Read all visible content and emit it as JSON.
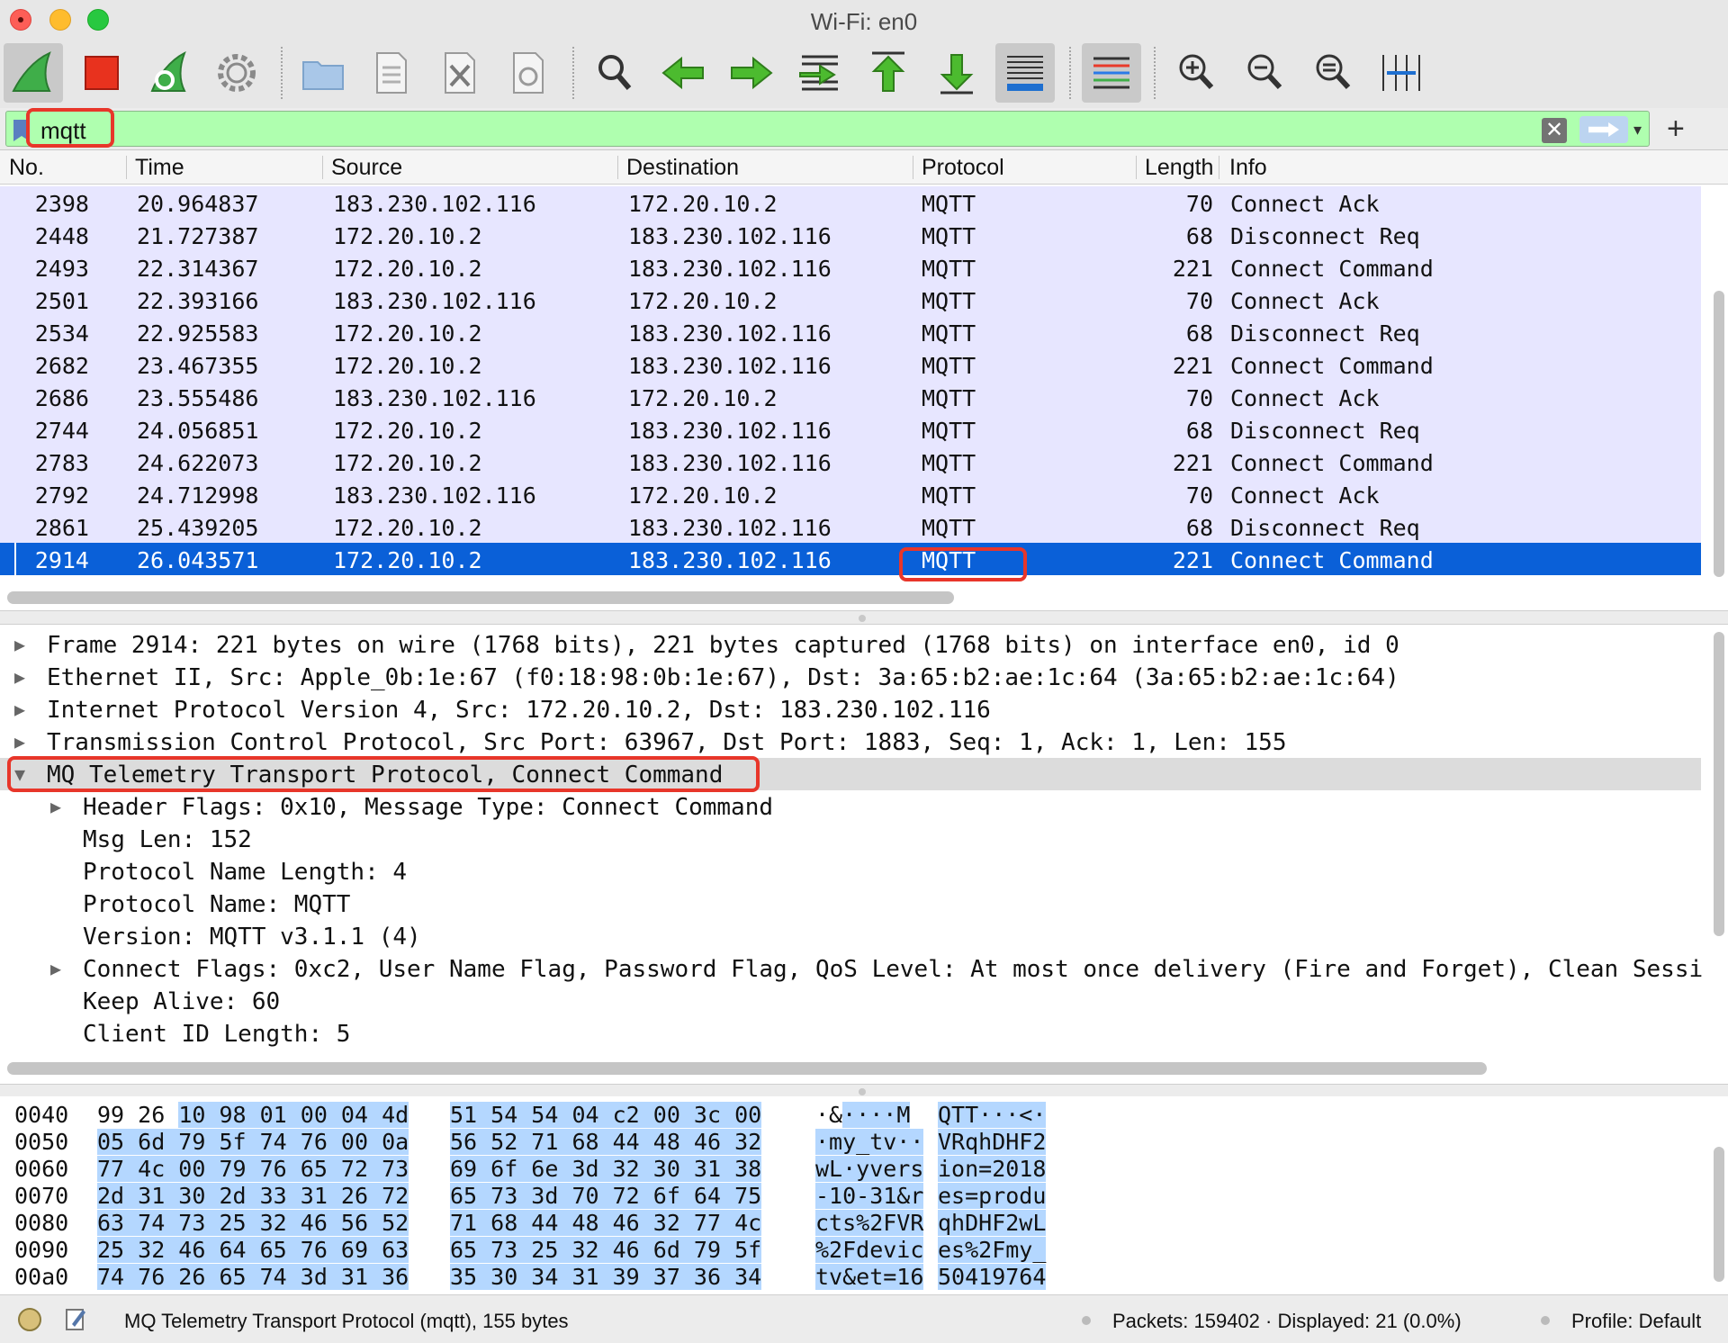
{
  "window": {
    "title": "Wi-Fi: en0"
  },
  "filter": {
    "value": "mqtt",
    "clear_label": "✕",
    "dropdown_label": "▾",
    "add_label": "+"
  },
  "packet_list": {
    "columns": [
      "No.",
      "Time",
      "Source",
      "Destination",
      "Protocol",
      "Length",
      "Info"
    ],
    "rows": [
      [
        "2398",
        "20.964837",
        "183.230.102.116",
        "172.20.10.2",
        "MQTT",
        "70",
        "Connect Ack"
      ],
      [
        "2448",
        "21.727387",
        "172.20.10.2",
        "183.230.102.116",
        "MQTT",
        "68",
        "Disconnect Req"
      ],
      [
        "2493",
        "22.314367",
        "172.20.10.2",
        "183.230.102.116",
        "MQTT",
        "221",
        "Connect Command"
      ],
      [
        "2501",
        "22.393166",
        "183.230.102.116",
        "172.20.10.2",
        "MQTT",
        "70",
        "Connect Ack"
      ],
      [
        "2534",
        "22.925583",
        "172.20.10.2",
        "183.230.102.116",
        "MQTT",
        "68",
        "Disconnect Req"
      ],
      [
        "2682",
        "23.467355",
        "172.20.10.2",
        "183.230.102.116",
        "MQTT",
        "221",
        "Connect Command"
      ],
      [
        "2686",
        "23.555486",
        "183.230.102.116",
        "172.20.10.2",
        "MQTT",
        "70",
        "Connect Ack"
      ],
      [
        "2744",
        "24.056851",
        "172.20.10.2",
        "183.230.102.116",
        "MQTT",
        "68",
        "Disconnect Req"
      ],
      [
        "2783",
        "24.622073",
        "172.20.10.2",
        "183.230.102.116",
        "MQTT",
        "221",
        "Connect Command"
      ],
      [
        "2792",
        "24.712998",
        "183.230.102.116",
        "172.20.10.2",
        "MQTT",
        "70",
        "Connect Ack"
      ],
      [
        "2861",
        "25.439205",
        "172.20.10.2",
        "183.230.102.116",
        "MQTT",
        "68",
        "Disconnect Req"
      ],
      [
        "2914",
        "26.043571",
        "172.20.10.2",
        "183.230.102.116",
        "MQTT",
        "221",
        "Connect Command"
      ]
    ],
    "selected_index": 11
  },
  "details": {
    "rows": [
      {
        "text": "Frame 2914: 221 bytes on wire (1768 bits), 221 bytes captured (1768 bits) on interface en0, id 0",
        "expander": "▶",
        "indent": 0
      },
      {
        "text": "Ethernet II, Src: Apple_0b:1e:67 (f0:18:98:0b:1e:67), Dst: 3a:65:b2:ae:1c:64 (3a:65:b2:ae:1c:64)",
        "expander": "▶",
        "indent": 0
      },
      {
        "text": "Internet Protocol Version 4, Src: 172.20.10.2, Dst: 183.230.102.116",
        "expander": "▶",
        "indent": 0
      },
      {
        "text": "Transmission Control Protocol, Src Port: 63967, Dst Port: 1883, Seq: 1, Ack: 1, Len: 155",
        "expander": "▶",
        "indent": 0
      },
      {
        "text": "MQ Telemetry Transport Protocol, Connect Command",
        "expander": "▼",
        "indent": 0,
        "highlight": true
      },
      {
        "text": "Header Flags: 0x10, Message Type: Connect Command",
        "expander": "▶",
        "indent": 1
      },
      {
        "text": "Msg Len: 152",
        "expander": "",
        "indent": 1
      },
      {
        "text": "Protocol Name Length: 4",
        "expander": "",
        "indent": 1
      },
      {
        "text": "Protocol Name: MQTT",
        "expander": "",
        "indent": 1
      },
      {
        "text": "Version: MQTT v3.1.1 (4)",
        "expander": "",
        "indent": 1
      },
      {
        "text": "Connect Flags: 0xc2, User Name Flag, Password Flag, QoS Level: At most once delivery (Fire and Forget), Clean Sessi",
        "expander": "▶",
        "indent": 1
      },
      {
        "text": "Keep Alive: 60",
        "expander": "",
        "indent": 1
      },
      {
        "text": "Client ID Length: 5",
        "expander": "",
        "indent": 1
      }
    ]
  },
  "hex": {
    "rows": [
      {
        "offset": "0040",
        "b1_plain": "99 26 ",
        "b1_sel": "10 98 01 00 04 4d",
        "b2": "51 54 54 04 c2 00 3c 00",
        "a1_plain": "·&",
        "a1_sel": "····M",
        "a2": "QTT···<·"
      },
      {
        "offset": "0050",
        "b1_plain": "",
        "b1_sel": "05 6d 79 5f 74 76 00 0a",
        "b2": "56 52 71 68 44 48 46 32",
        "a1_plain": "",
        "a1_sel": "·my_tv··",
        "a2": "VRqhDHF2"
      },
      {
        "offset": "0060",
        "b1_plain": "",
        "b1_sel": "77 4c 00 79 76 65 72 73",
        "b2": "69 6f 6e 3d 32 30 31 38",
        "a1_plain": "",
        "a1_sel": "wL·yvers",
        "a2": "ion=2018"
      },
      {
        "offset": "0070",
        "b1_plain": "",
        "b1_sel": "2d 31 30 2d 33 31 26 72",
        "b2": "65 73 3d 70 72 6f 64 75",
        "a1_plain": "",
        "a1_sel": "-10-31&r",
        "a2": "es=produ"
      },
      {
        "offset": "0080",
        "b1_plain": "",
        "b1_sel": "63 74 73 25 32 46 56 52",
        "b2": "71 68 44 48 46 32 77 4c",
        "a1_plain": "",
        "a1_sel": "cts%2FVR",
        "a2": "qhDHF2wL"
      },
      {
        "offset": "0090",
        "b1_plain": "",
        "b1_sel": "25 32 46 64 65 76 69 63",
        "b2": "65 73 25 32 46 6d 79 5f",
        "a1_plain": "",
        "a1_sel": "%2Fdevic",
        "a2": "es%2Fmy_"
      },
      {
        "offset": "00a0",
        "b1_plain": "",
        "b1_sel": "74 76 26 65 74 3d 31 36",
        "b2": "35 30 34 31 39 37 36 34",
        "a1_plain": "",
        "a1_sel": "tv&et=16",
        "a2": "50419764"
      }
    ]
  },
  "status": {
    "message": "MQ Telemetry Transport Protocol (mqtt), 155 bytes",
    "packets": "Packets: 159402 · Displayed: 21 (0.0%)",
    "profile": "Profile: Default"
  },
  "colors": {
    "row_bg": "#e7e6ff",
    "selected_bg": "#0a60d8",
    "filter_bg": "#afffaf",
    "annotation": "#e8362a",
    "hex_selection": "#b4d7ff"
  }
}
